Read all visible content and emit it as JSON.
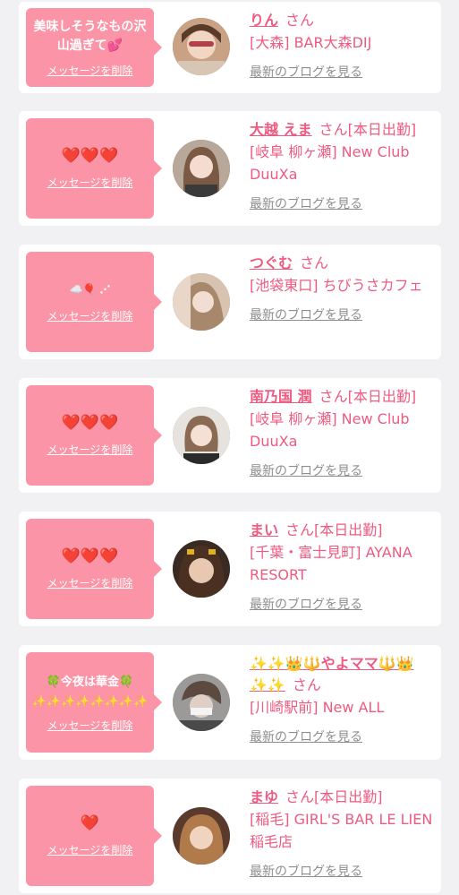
{
  "cards": [
    {
      "message": "美味しそうなもの沢山過ぎて💕",
      "delete_label": "メッセージを削除",
      "name": "りん",
      "suffix": "さん",
      "shop": "[大森] BAR大森DIJ",
      "blog_link": "最新のブログを見る"
    },
    {
      "message": "❤️❤️❤️",
      "delete_label": "メッセージを削除",
      "name": "大越 えま",
      "suffix": "さん[本日出勤]",
      "shop": "[岐阜 柳ヶ瀬] New Club DuuXa",
      "blog_link": "最新のブログを見る"
    },
    {
      "message": "☁️🎈 ⋰",
      "delete_label": "メッセージを削除",
      "name": "つぐむ",
      "suffix": "さん",
      "shop": "[池袋東口] ちびうさカフェ",
      "blog_link": "最新のブログを見る"
    },
    {
      "message": "❤️❤️❤️",
      "delete_label": "メッセージを削除",
      "name": "南乃国 潤",
      "suffix": "さん[本日出勤]",
      "shop": "[岐阜 柳ヶ瀬] New Club DuuXa",
      "blog_link": "最新のブログを見る"
    },
    {
      "message": "❤️❤️❤️",
      "delete_label": "メッセージを削除",
      "name": "まい",
      "suffix": "さん[本日出勤]",
      "shop": "[千葉・富士見町] AYANA RESORT",
      "blog_link": "最新のブログを見る"
    },
    {
      "message": "🍀今夜は華金🍀 ✨✨✨✨✨✨✨✨",
      "delete_label": "メッセージを削除",
      "name": "✨✨👑🔱やよママ🔱👑✨✨",
      "suffix": "さん",
      "shop": "[川崎駅前] New ALL",
      "blog_link": "最新のブログを見る"
    },
    {
      "message": "❤️",
      "delete_label": "メッセージを削除",
      "name": "まゆ",
      "suffix": "さん[本日出勤]",
      "shop": "[稲毛] GIRL'S BAR LE LIEN 稲毛店",
      "blog_link": "最新のブログを見る"
    }
  ]
}
